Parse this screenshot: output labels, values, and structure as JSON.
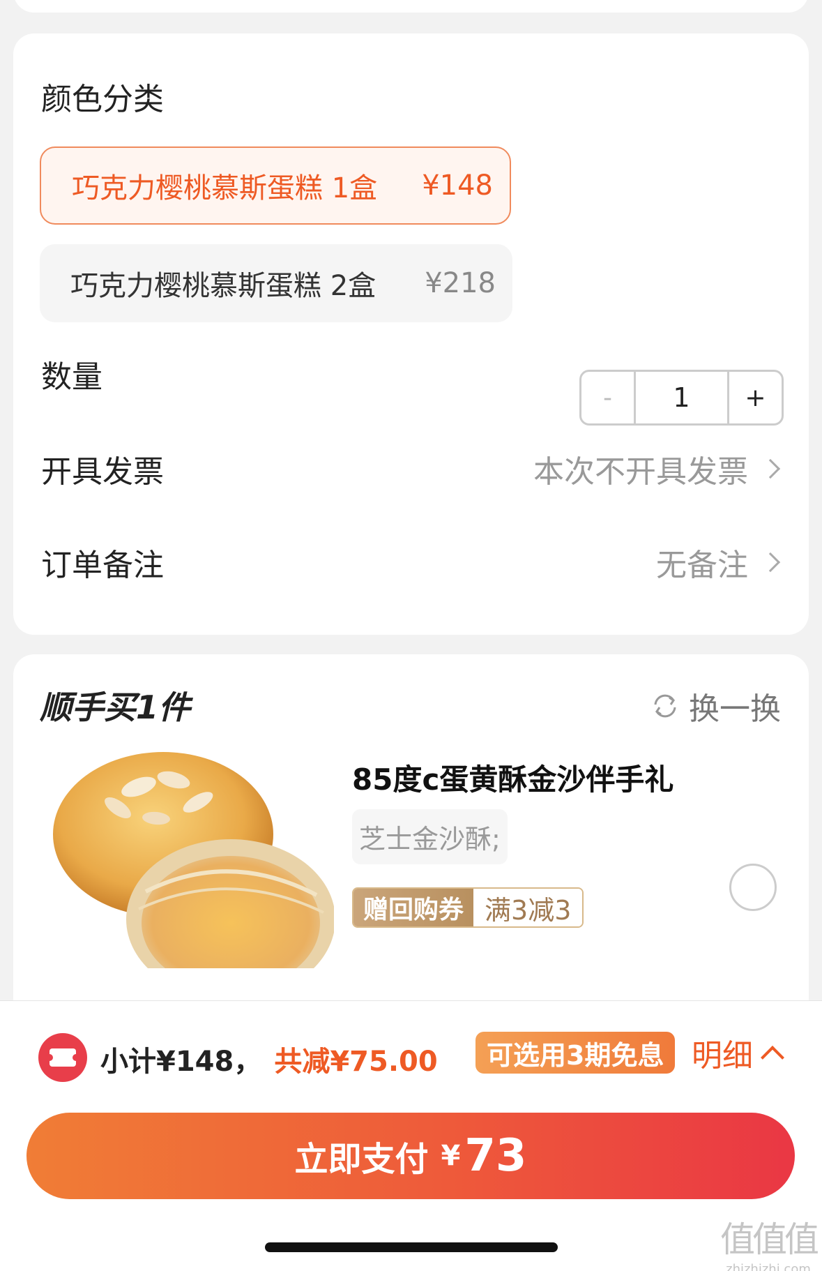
{
  "options": {
    "section_title": "颜色分类",
    "variants": [
      {
        "name": "巧克力樱桃慕斯蛋糕 1盒",
        "price": "¥148",
        "selected": true
      },
      {
        "name": "巧克力樱桃慕斯蛋糕 2盒",
        "price": "¥218",
        "selected": false
      }
    ],
    "quantity": {
      "label": "数量",
      "minus": "-",
      "value": "1",
      "plus": "+"
    },
    "invoice": {
      "label": "开具发票",
      "value": "本次不开具发票"
    },
    "remark": {
      "label": "订单备注",
      "value": "无备注"
    }
  },
  "recommend": {
    "title": "顺手买1件",
    "swap_label": "换一换",
    "product": {
      "title": "85度c蛋黄酥金沙伴手礼",
      "spec": "芝士金沙酥;",
      "coupon_tag": "赠回购券",
      "coupon_rule": "满3减3",
      "selected": false
    }
  },
  "bottom": {
    "subtotal": "小计¥148，",
    "discount": "共减¥75.00",
    "installment": "可选用3期免息",
    "detail_label": "明细",
    "pay": {
      "label": "立即支付",
      "currency": "¥",
      "amount": "73"
    }
  },
  "watermark": {
    "text": "值值值",
    "url": "zhizhizhi.com"
  },
  "colors": {
    "accent": "#ee5a24",
    "pay_gradient_start": "#f07d36",
    "pay_gradient_end": "#ea3744",
    "coupon_gold": "#b8905f"
  },
  "icons": [
    "chevron-right-icon",
    "refresh-icon",
    "ticket-icon",
    "chevron-up-icon"
  ]
}
